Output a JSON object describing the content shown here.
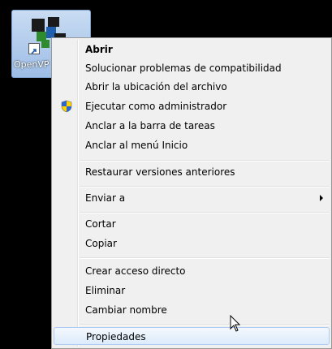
{
  "desktop": {
    "icon_label": "OpenVP"
  },
  "context_menu": {
    "items": [
      {
        "label": "Abrir",
        "bold": true
      },
      {
        "label": "Solucionar problemas de compatibilidad"
      },
      {
        "label": "Abrir la ubicación del archivo"
      },
      {
        "label": "Ejecutar como administrador",
        "icon": "uac-shield-icon"
      },
      {
        "label": "Anclar a la barra de tareas"
      },
      {
        "label": "Anclar al menú Inicio"
      },
      {
        "label": "Restaurar versiones anteriores"
      },
      {
        "label": "Enviar a",
        "submenu": true
      },
      {
        "label": "Cortar"
      },
      {
        "label": "Copiar"
      },
      {
        "label": "Crear acceso directo"
      },
      {
        "label": "Eliminar"
      },
      {
        "label": "Cambiar nombre"
      },
      {
        "label": "Propiedades",
        "hovered": true
      }
    ]
  },
  "colors": {
    "desktop_background": "#000000",
    "menu_background": "#f0f0f0",
    "hover_border": "#aeccf1"
  }
}
